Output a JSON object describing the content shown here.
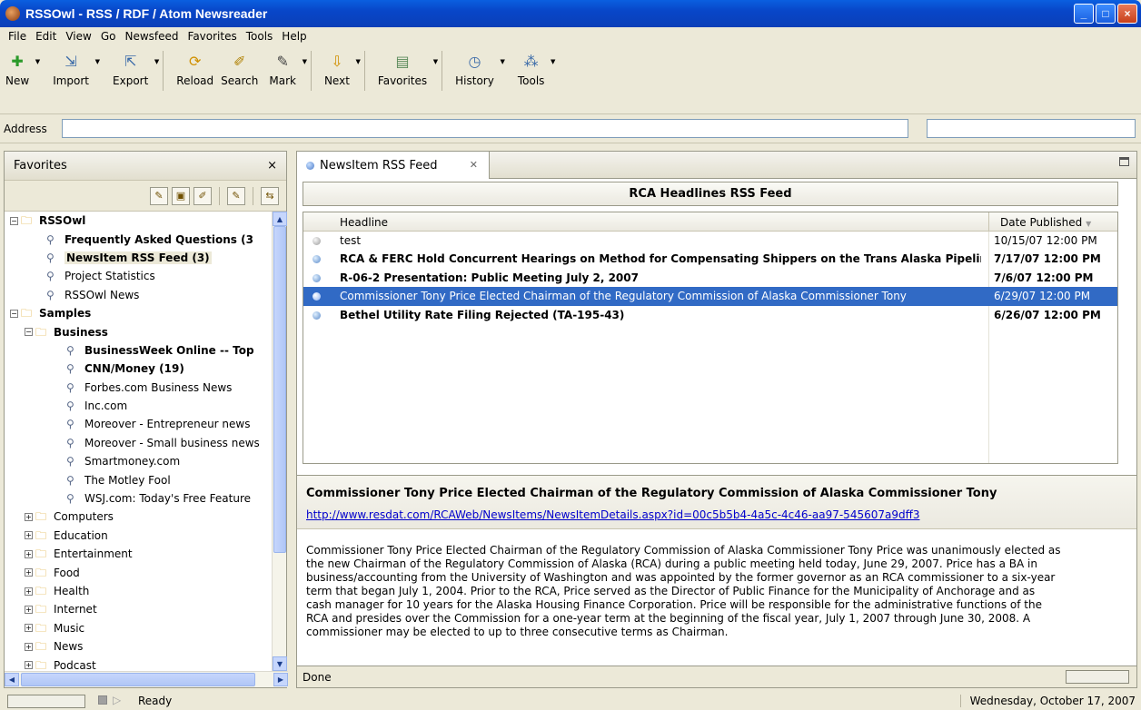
{
  "window": {
    "title": "RSSOwl - RSS / RDF / Atom Newsreader",
    "buttons": [
      "_",
      "□",
      "×"
    ]
  },
  "menu": [
    "File",
    "Edit",
    "View",
    "Go",
    "Newsfeed",
    "Favorites",
    "Tools",
    "Help"
  ],
  "toolbar": {
    "buttons": [
      {
        "label": "New",
        "icon": "plus-icon"
      },
      {
        "label": "Import",
        "icon": "import-icon"
      },
      {
        "label": "Export",
        "icon": "export-icon"
      },
      {
        "label": "Reload",
        "icon": "reload-icon"
      },
      {
        "label": "Search",
        "icon": "search-icon"
      },
      {
        "label": "Mark",
        "icon": "mark-icon"
      },
      {
        "label": "Next",
        "icon": "next-icon"
      },
      {
        "label": "Favorites",
        "icon": "favorites-icon"
      },
      {
        "label": "History",
        "icon": "history-icon"
      },
      {
        "label": "Tools",
        "icon": "tools-icon"
      }
    ]
  },
  "address": {
    "label": "Address",
    "value": "",
    "search_value": ""
  },
  "favorites": {
    "title": "Favorites",
    "close": "×",
    "tree": [
      {
        "label": "RSSOwl",
        "level": 0,
        "type": "folder",
        "bold": true,
        "expanded": true
      },
      {
        "label": "Frequently Asked Questions (3",
        "level": 1,
        "type": "feed",
        "bold": true
      },
      {
        "label": "NewsItem RSS Feed (3)",
        "level": 1,
        "type": "feed",
        "bold": true,
        "selected": true
      },
      {
        "label": "Project Statistics",
        "level": 1,
        "type": "feed",
        "bold": false
      },
      {
        "label": "RSSOwl News",
        "level": 1,
        "type": "feed",
        "bold": false
      },
      {
        "label": "Samples",
        "level": 0,
        "type": "folder",
        "bold": true,
        "expanded": true
      },
      {
        "label": "Business",
        "level": 1,
        "type": "folder",
        "bold": true,
        "expanded": true
      },
      {
        "label": "BusinessWeek Online -- Top",
        "level": 2,
        "type": "feed",
        "bold": true
      },
      {
        "label": "CNN/Money (19)",
        "level": 2,
        "type": "feed",
        "bold": true
      },
      {
        "label": "Forbes.com Business News",
        "level": 2,
        "type": "feed",
        "bold": false
      },
      {
        "label": "Inc.com",
        "level": 2,
        "type": "feed",
        "bold": false
      },
      {
        "label": "Moreover - Entrepreneur news",
        "level": 2,
        "type": "feed",
        "bold": false
      },
      {
        "label": "Moreover - Small business news",
        "level": 2,
        "type": "feed",
        "bold": false
      },
      {
        "label": "Smartmoney.com",
        "level": 2,
        "type": "feed",
        "bold": false
      },
      {
        "label": "The Motley Fool",
        "level": 2,
        "type": "feed",
        "bold": false
      },
      {
        "label": "WSJ.com: Today's Free Feature",
        "level": 2,
        "type": "feed",
        "bold": false
      },
      {
        "label": "Computers",
        "level": 1,
        "type": "folder",
        "bold": false,
        "expanded": false
      },
      {
        "label": "Education",
        "level": 1,
        "type": "folder",
        "bold": false,
        "expanded": false
      },
      {
        "label": "Entertainment",
        "level": 1,
        "type": "folder",
        "bold": false,
        "expanded": false
      },
      {
        "label": "Food",
        "level": 1,
        "type": "folder",
        "bold": false,
        "expanded": false
      },
      {
        "label": "Health",
        "level": 1,
        "type": "folder",
        "bold": false,
        "expanded": false
      },
      {
        "label": "Internet",
        "level": 1,
        "type": "folder",
        "bold": false,
        "expanded": false
      },
      {
        "label": "Music",
        "level": 1,
        "type": "folder",
        "bold": false,
        "expanded": false
      },
      {
        "label": "News",
        "level": 1,
        "type": "folder",
        "bold": false,
        "expanded": false
      },
      {
        "label": "Podcast",
        "level": 1,
        "type": "folder",
        "bold": false,
        "expanded": false
      }
    ]
  },
  "tab": {
    "label": "NewsItem RSS Feed"
  },
  "feed": {
    "title": "RCA Headlines RSS Feed",
    "col_headline": "Headline",
    "col_date": "Date Published",
    "rows": [
      {
        "headline": "test",
        "date": "10/15/07 12:00 PM",
        "read": true,
        "selected": false
      },
      {
        "headline": "RCA & FERC Hold Concurrent Hearings on Method for Compensating Shippers on the Trans Alaska Pipelin",
        "date": "7/17/07 12:00 PM",
        "read": false,
        "selected": false
      },
      {
        "headline": "R-06-2 Presentation: Public Meeting July 2, 2007",
        "date": "7/6/07 12:00 PM",
        "read": false,
        "selected": false
      },
      {
        "headline": "Commissioner Tony Price Elected Chairman of the Regulatory Commission of Alaska Commissioner Tony",
        "date": "6/29/07 12:00 PM",
        "read": true,
        "selected": true
      },
      {
        "headline": "Bethel Utility Rate Filing Rejected (TA-195-43)",
        "date": "6/26/07 12:00 PM",
        "read": false,
        "selected": false
      }
    ]
  },
  "detail": {
    "title": "Commissioner Tony Price Elected Chairman of the Regulatory Commission of Alaska Commissioner Tony",
    "link": "http://www.resdat.com/RCAWeb/NewsItems/NewsItemDetails.aspx?id=00c5b5b4-4a5c-4c46-aa97-545607a9dff3",
    "body_lines": [
      "Commissioner Tony Price Elected Chairman of the Regulatory Commission of Alaska Commissioner Tony Price was unanimously elected as",
      "the new Chairman of the Regulatory Commission of Alaska (RCA) during a public meeting held today, June 29, 2007. Price has a BA in",
      "business/accounting from the University of Washington and was appointed by the former governor as an RCA commissioner to a six-year",
      "term that began July 1, 2004. Prior to the RCA, Price served as the Director of Public Finance for the Municipality of Anchorage and as",
      "cash manager for 10 years for the Alaska Housing Finance Corporation. Price will be responsible for the administrative functions of the",
      "RCA and presides over the Commission for a one-year term at the beginning of the fiscal year, July 1, 2007 through June 30, 2008. A",
      "commissioner may be elected to up to three consecutive terms as Chairman."
    ]
  },
  "panel_status": "Done",
  "statusbar": {
    "status": "Ready",
    "date": "Wednesday, October 17, 2007"
  }
}
